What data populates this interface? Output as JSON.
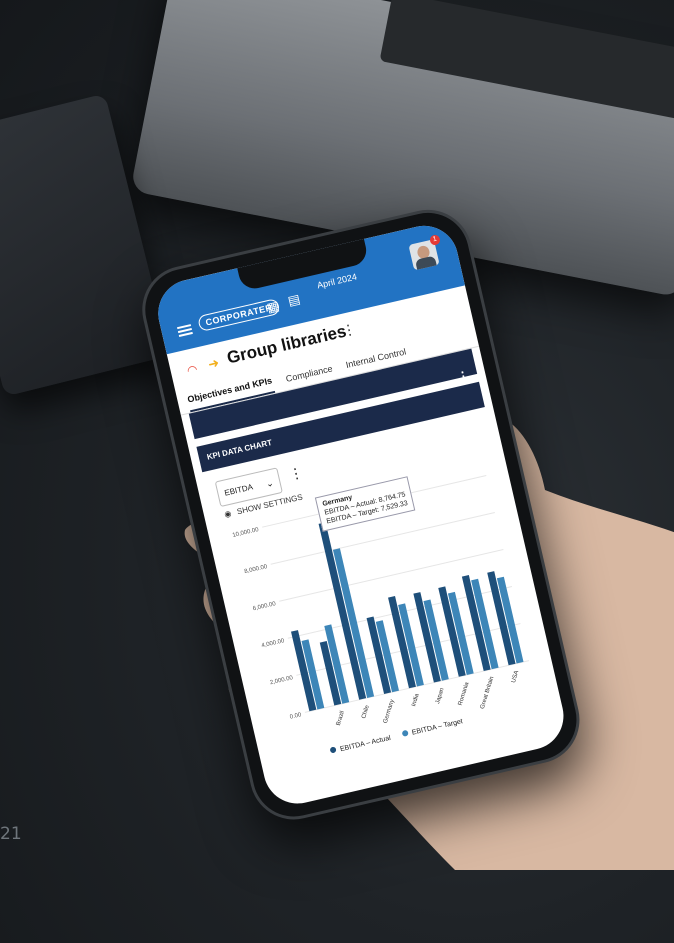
{
  "background_text": "21",
  "app": {
    "brand": "CORPORATER",
    "date": "April 2024",
    "notification_count": "1",
    "page_title": "Group libraries"
  },
  "tabs": [
    "Objectives and KPIs",
    "Compliance",
    "Internal Control"
  ],
  "section": {
    "title": "KPI DATA CHART"
  },
  "controls": {
    "selected_kpi": "EBITDA",
    "show_settings": "SHOW SETTINGS"
  },
  "tooltip": {
    "country": "Germany",
    "actual": "EBITDA – Actual: 8,764.75",
    "target": "EBITDA – Target: 7,529.33"
  },
  "colors": {
    "brand_blue": "#2273c3",
    "navy": "#1b2a4a",
    "actual": "#1e4f7a",
    "target": "#3d86b8"
  },
  "chart_data": {
    "type": "bar",
    "categories": [
      "",
      "Brazil",
      "Chile",
      "Germany",
      "India",
      "Japan",
      "Romania",
      "Great Britain",
      "USA"
    ],
    "series": [
      {
        "name": "EBITDA – Actual",
        "values": [
          4300,
          3400,
          9500,
          4100,
          4900,
          4800,
          4800,
          5100,
          5000
        ]
      },
      {
        "name": "EBITDA – Target",
        "values": [
          3700,
          4200,
          8000,
          3800,
          4400,
          4300,
          4400,
          4800,
          4600
        ]
      }
    ],
    "y_ticks": [
      "0.00",
      "2,000.00",
      "4,000.00",
      "6,000.00",
      "8,000.00",
      "10,000.00"
    ],
    "ylim": [
      0,
      10000
    ],
    "legend_position": "bottom",
    "grid": true
  }
}
